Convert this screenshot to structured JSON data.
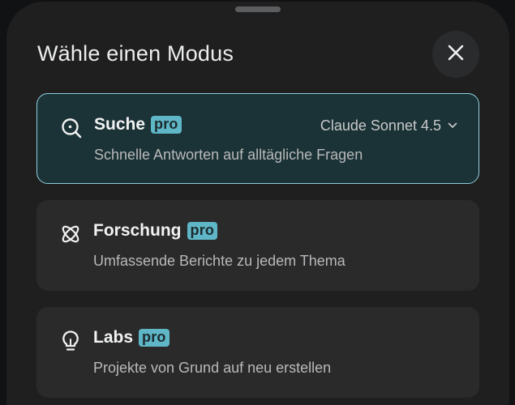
{
  "sheet": {
    "title": "Wähle einen Modus",
    "close_icon": "close-icon"
  },
  "modes": [
    {
      "title": "Suche",
      "badge": "pro",
      "description": "Schnelle Antworten auf alltägliche Fragen",
      "icon": "search-icon",
      "selected": true,
      "model": "Claude Sonnet 4.5"
    },
    {
      "title": "Forschung",
      "badge": "pro",
      "description": "Umfassende Berichte zu jedem Thema",
      "icon": "research-icon",
      "selected": false
    },
    {
      "title": "Labs",
      "badge": "pro",
      "description": "Projekte von Grund auf neu erstellen",
      "icon": "lightbulb-icon",
      "selected": false
    }
  ],
  "colors": {
    "background": "#111214",
    "sheet": "#1f1f20",
    "card": "#2a2a2b",
    "selected_card": "#1b3236",
    "selected_border": "#8fd0dc",
    "badge": "#5fb6c7"
  }
}
